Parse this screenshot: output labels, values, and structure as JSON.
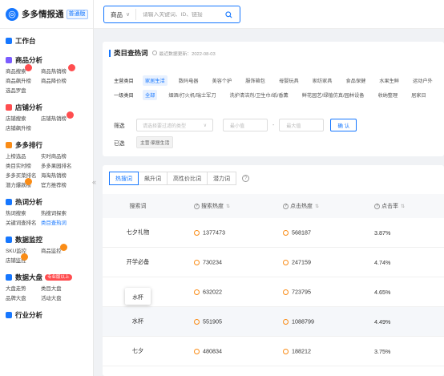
{
  "app": {
    "name": "多多情报通",
    "edition": "普通版",
    "logo_char": "◎"
  },
  "sidebar": {
    "workbench": "工作台",
    "sections": [
      {
        "title": "商品分析",
        "icon": "bag-icon",
        "color": "#7b5cff",
        "items": [
          {
            "label": "商品搜索",
            "hot": true
          },
          {
            "label": "商品热销榜",
            "hot": true
          },
          {
            "label": "商品飙升榜"
          },
          {
            "label": "商品降价榜"
          },
          {
            "label": "选品罗盘"
          }
        ]
      },
      {
        "title": "店铺分析",
        "icon": "store-icon",
        "color": "#ff4d4f",
        "items": [
          {
            "label": "店铺搜索"
          },
          {
            "label": "店铺热销榜",
            "hot": true
          },
          {
            "label": "店铺飙升榜"
          }
        ]
      },
      {
        "title": "多多排行",
        "icon": "rank-icon",
        "color": "#fa8c16",
        "items": [
          {
            "label": "上榜选品"
          },
          {
            "label": "实时商品榜"
          },
          {
            "label": "类目实时榜"
          },
          {
            "label": "多多果园排名"
          },
          {
            "label": "多多买菜排名"
          },
          {
            "label": "海淘热销榜"
          },
          {
            "label": "潜力爆款榜",
            "hot": true
          },
          {
            "label": "官方推荐榜"
          }
        ]
      },
      {
        "title": "热词分析",
        "icon": "hotword-icon",
        "color": "#1677ff",
        "items": [
          {
            "label": "热词搜索"
          },
          {
            "label": "热搜词探索"
          },
          {
            "label": "关键词查排名"
          },
          {
            "label": "类目查热词",
            "active": true
          }
        ]
      },
      {
        "title": "数据监控",
        "icon": "monitor-icon",
        "color": "#1677ff",
        "items": [
          {
            "label": "SKU监控"
          },
          {
            "label": "商品监控",
            "hot": true
          },
          {
            "label": "店铺监控",
            "hot": true
          }
        ]
      },
      {
        "title": "数据大盘",
        "tag": "专业版以上",
        "icon": "dashboard-icon",
        "color": "#1677ff",
        "items": [
          {
            "label": "大盘走势"
          },
          {
            "label": "类目大盘"
          },
          {
            "label": "品牌大盘"
          },
          {
            "label": "活动大盘"
          }
        ]
      },
      {
        "title": "行业分析",
        "icon": "industry-icon",
        "color": "#1677ff",
        "items": []
      }
    ]
  },
  "search": {
    "type": "商品",
    "placeholder": "请输入关键词、ID、链接"
  },
  "category_card": {
    "title": "类目查热词",
    "update_time": "最近数据更新：2022-08-03",
    "main_category_label": "主营类目",
    "main_categories": [
      {
        "label": "家居生活",
        "active": true
      },
      {
        "label": "数码电器"
      },
      {
        "label": "美容个护"
      },
      {
        "label": "服饰箱包"
      },
      {
        "label": "母婴玩具"
      },
      {
        "label": "家纺家具"
      },
      {
        "label": "食品保健"
      },
      {
        "label": "水果生鲜"
      },
      {
        "label": "运动户外"
      }
    ],
    "sub_category_label": "一级类目",
    "sub_categories": [
      {
        "label": "全部",
        "active": true
      },
      {
        "label": "烟酒/打火机/瑞士军刀"
      },
      {
        "label": "洗护清洁剂/卫生巾/纸/香薰"
      },
      {
        "label": "鲜花园艺/绿植仿真/园林设备"
      },
      {
        "label": "收纳整理"
      },
      {
        "label": "居家日"
      }
    ],
    "filter_label": "筛选",
    "filter_placeholder": "请选择要过滤的类型",
    "min_placeholder": "最小值",
    "range_sep": "-",
    "max_placeholder": "最大值",
    "confirm_label": "确 认",
    "selected_label": "已选",
    "selected_chip": "主营:家居生活"
  },
  "results": {
    "tabs": [
      {
        "label": "热搜词",
        "active": true
      },
      {
        "label": "飙升词"
      },
      {
        "label": "高性价比词"
      },
      {
        "label": "潜力词"
      }
    ],
    "columns": [
      "搜索词",
      "搜索热度",
      "点击热度",
      "点击率"
    ],
    "rows": [
      {
        "keyword": "七夕礼物",
        "search_heat": "1377473",
        "click_heat": "568187",
        "ctr": "3.87%"
      },
      {
        "keyword": "开学必备",
        "search_heat": "730234",
        "click_heat": "247159",
        "ctr": "4.74%"
      },
      {
        "keyword": "",
        "search_heat": "632022",
        "click_heat": "723795",
        "ctr": "4.65%"
      },
      {
        "keyword": "水杯",
        "search_heat": "551905",
        "click_heat": "1088799",
        "ctr": "4.49%"
      },
      {
        "keyword": "七夕",
        "search_heat": "480834",
        "click_heat": "188212",
        "ctr": "3.75%"
      }
    ],
    "tooltip": "水杯"
  },
  "colors": {
    "accent": "#1677ff",
    "flame": "#fa8c16",
    "hot_badge": "#ff4d4f"
  }
}
